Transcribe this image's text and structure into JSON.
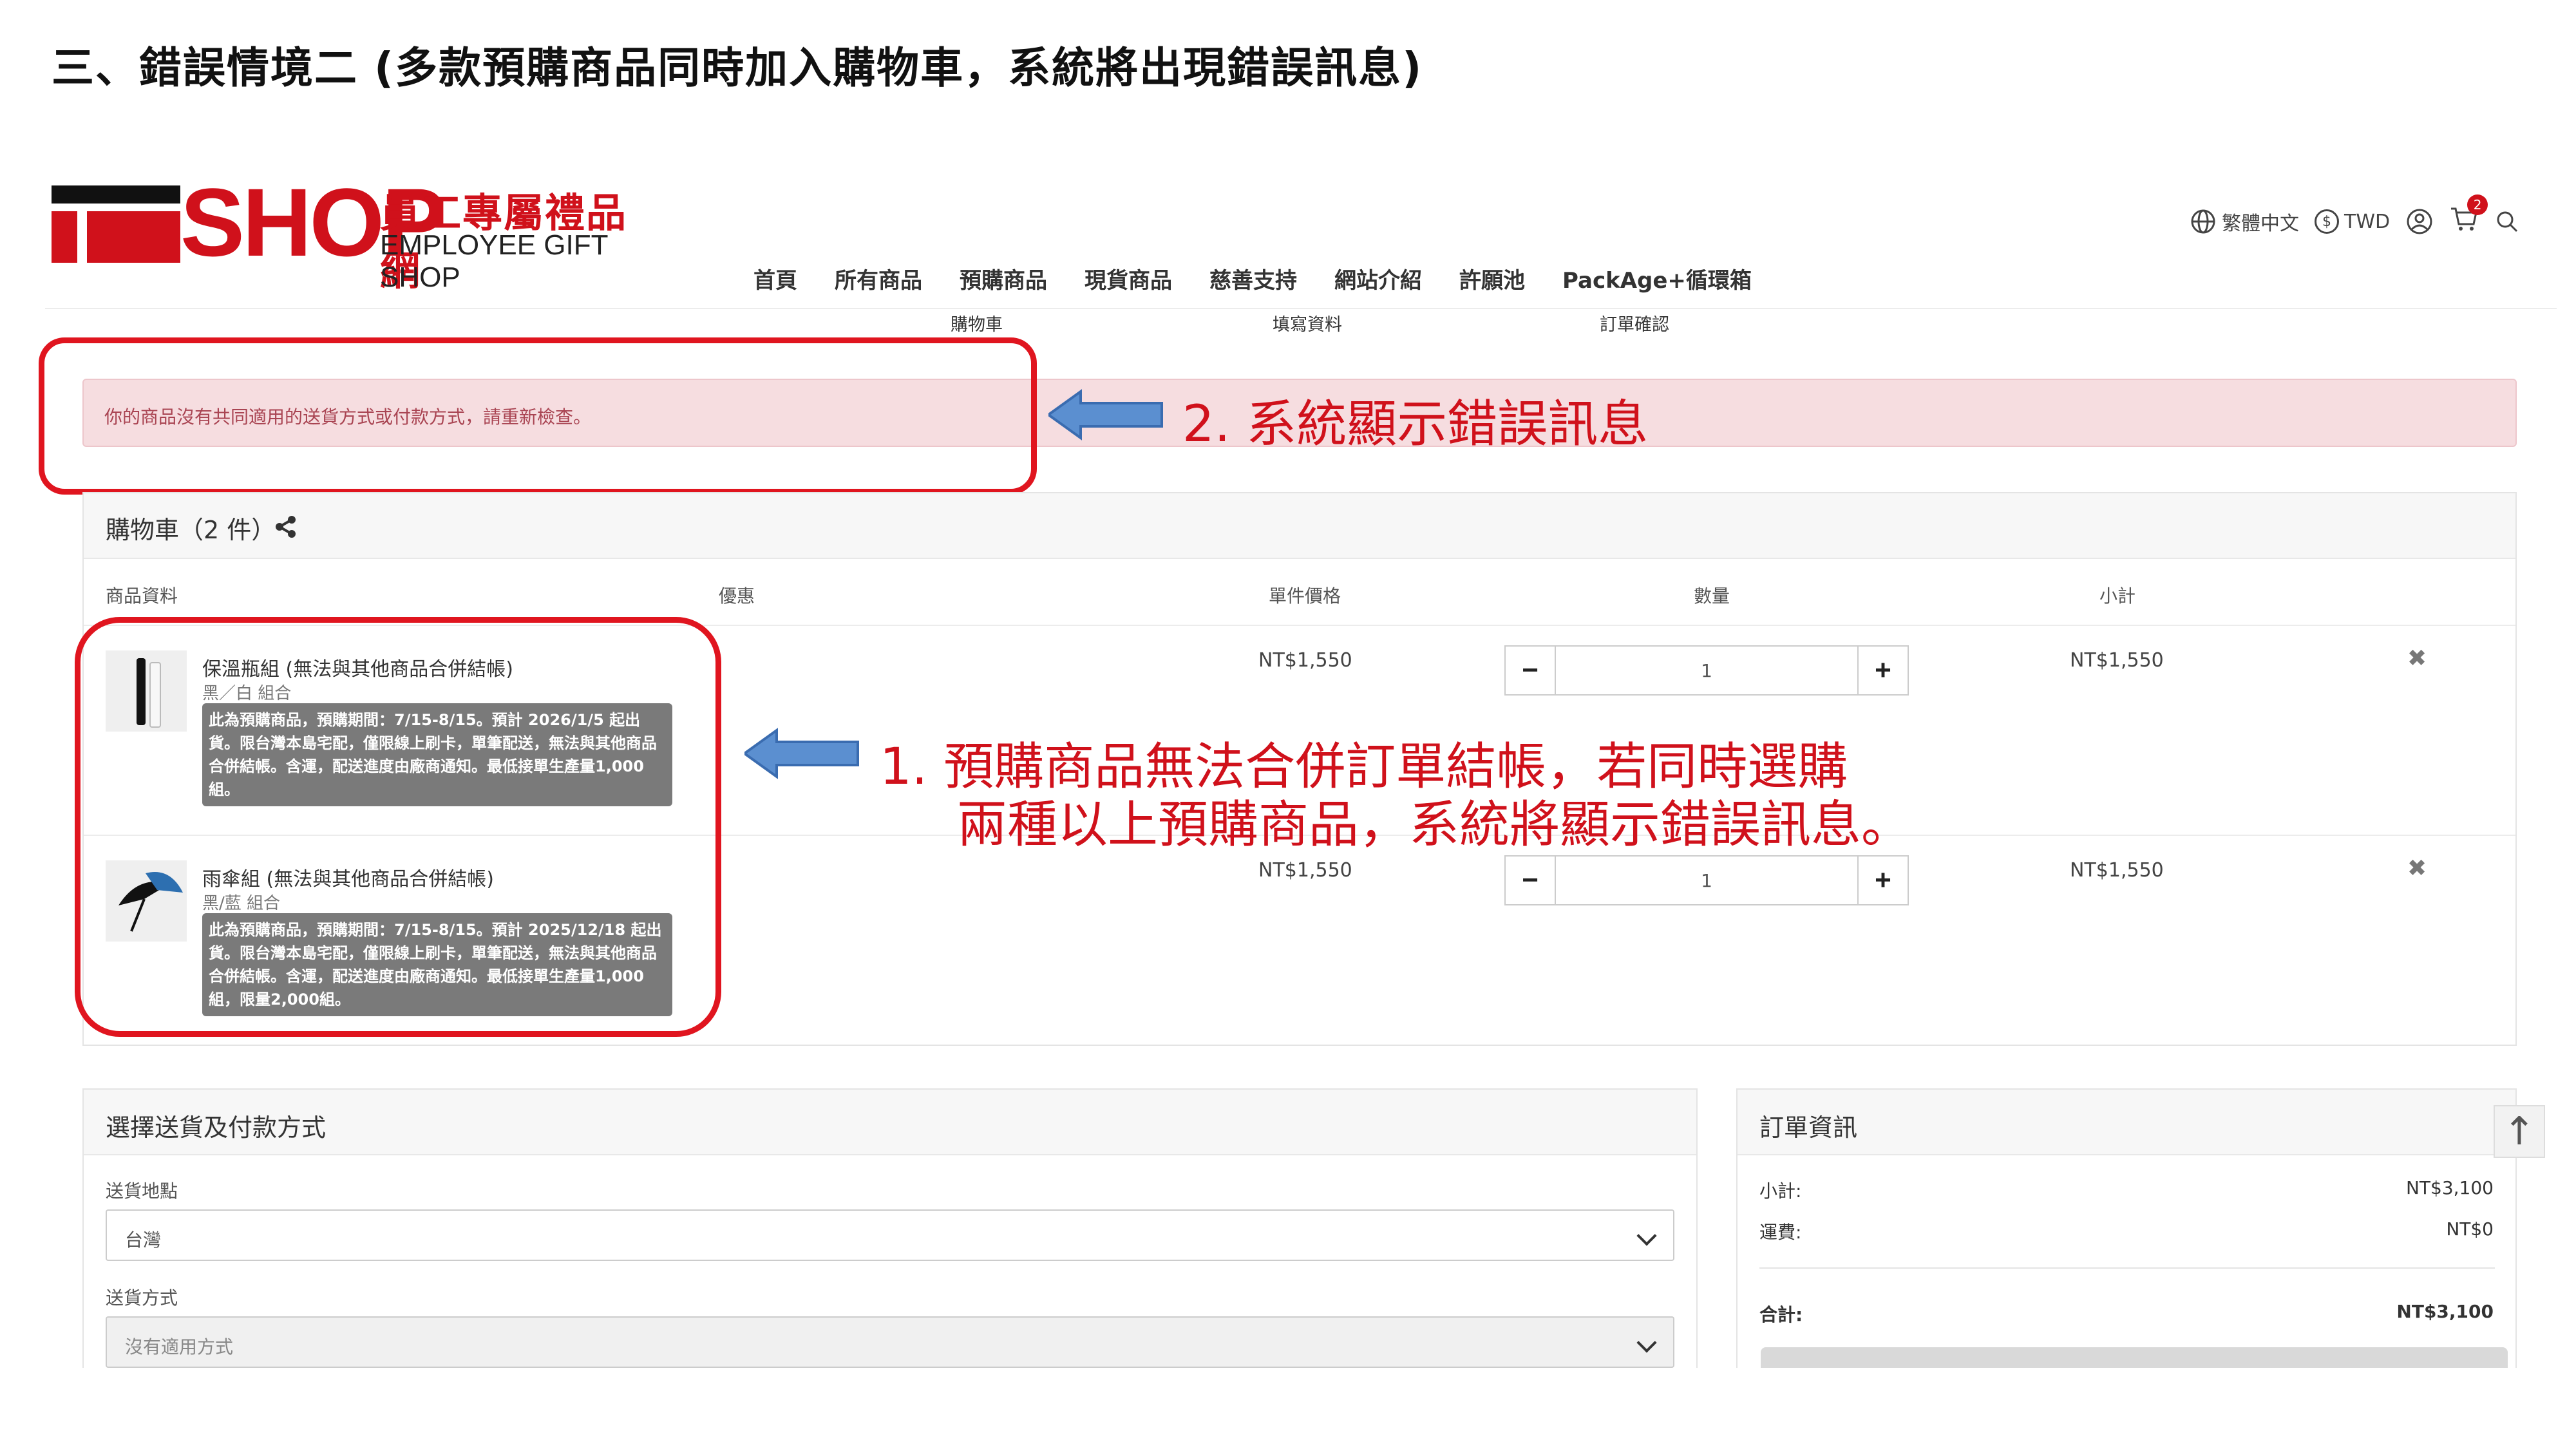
{
  "heading": "三、錯誤情境二 (多款預購商品同時加入購物車，系統將出現錯誤訊息)",
  "logo": {
    "shop": "SHOP",
    "zh": "員工專屬禮品網",
    "en": "EMPLOYEE GIFT SHOP"
  },
  "header": {
    "language": "繁體中文",
    "currency": "TWD",
    "cart_count": "2"
  },
  "nav": [
    "首頁",
    "所有商品",
    "預購商品",
    "現貨商品",
    "慈善支持",
    "網站介紹",
    "許願池",
    "PackAge+循環箱"
  ],
  "steps": [
    "購物車",
    "填寫資料",
    "訂單確認"
  ],
  "error_message": "你的商品沒有共同適用的送貨方式或付款方式，請重新檢查。",
  "annotations": {
    "a2": "2.  系統顯示錯誤訊息",
    "a1_line1": "1.  預購商品無法合併訂單結帳，若同時選購",
    "a1_line2": "兩種以上預購商品，系統將顯示錯誤訊息。"
  },
  "cart": {
    "title": "購物車（2 件）",
    "columns": {
      "product": "商品資料",
      "discount": "優惠",
      "unit_price": "單件價格",
      "quantity": "數量",
      "subtotal": "小計"
    },
    "items": [
      {
        "name": "保溫瓶組 (無法與其他商品合併結帳)",
        "variant": "黑／白 組合",
        "note": "此為預購商品，預購期間：7/15-8/15。預計 2026/1/5 起出貨。限台灣本島宅配，僅限線上刷卡，單筆配送，無法與其他商品合併結帳。含運，配送進度由廠商通知。最低接單生產量1,000 組。",
        "price": "NT$1,550",
        "quantity": "1",
        "subtotal": "NT$1,550"
      },
      {
        "name": "雨傘組 (無法與其他商品合併結帳)",
        "variant": "黑/藍 組合",
        "note": "此為預購商品，預購期間：7/15-8/15。預計 2025/12/18 起出貨。限台灣本島宅配，僅限線上刷卡，單筆配送，無法與其他商品合併結帳。含運，配送進度由廠商通知。最低接單生產量1,000 組，限量2,000組。",
        "price": "NT$1,550",
        "quantity": "1",
        "subtotal": "NT$1,550"
      }
    ]
  },
  "shipping": {
    "title": "選擇送貨及付款方式",
    "location_label": "送貨地點",
    "location_value": "台灣",
    "method_label": "送貨方式",
    "method_value": "沒有適用方式"
  },
  "order": {
    "title": "訂單資訊",
    "subtotal_label": "小計:",
    "subtotal_value": "NT$3,100",
    "shipping_label": "運費:",
    "shipping_value": "NT$0",
    "total_label": "合計:",
    "total_value": "NT$3,100"
  }
}
